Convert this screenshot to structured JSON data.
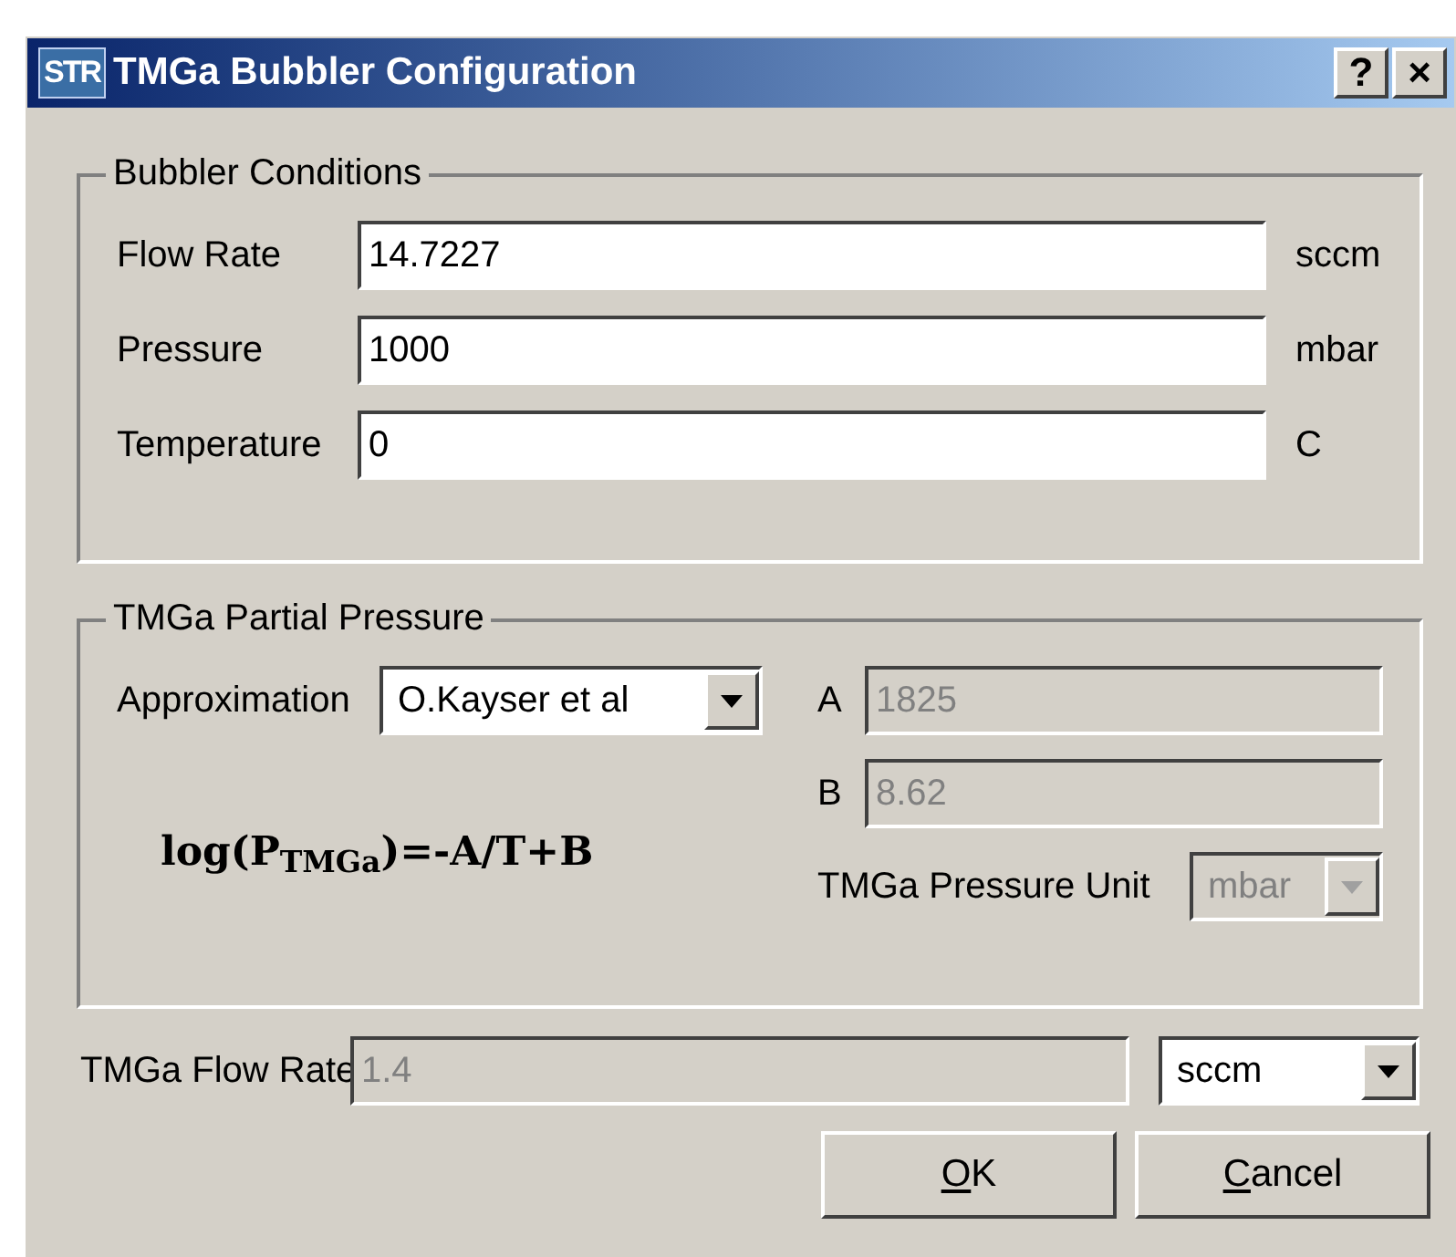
{
  "window": {
    "title": "TMGa Bubbler Configuration",
    "logo": "STR",
    "buttons": [
      "?",
      "×"
    ]
  },
  "bubbler_conditions": {
    "title": "Bubbler Conditions",
    "rows": [
      {
        "label": "Flow Rate",
        "value": "14.7227",
        "unit": "sccm"
      },
      {
        "label": "Pressure",
        "value": "1000",
        "unit": "mbar"
      },
      {
        "label": "Temperature",
        "value": "0",
        "unit": "C"
      }
    ]
  },
  "partial_pressure": {
    "title": "TMGa Partial Pressure",
    "approximation": {
      "label": "Approximation",
      "value": "O.Kayser et al"
    },
    "formula": "log(P$_{TMGa}$)=-A/T+B",
    "params": [
      {
        "label": "A",
        "value": "1825",
        "disabled": true
      },
      {
        "label": "B",
        "value": "8.62",
        "disabled": true
      }
    ],
    "unit": {
      "label": "TMGa Pressure Unit",
      "value": "mbar",
      "disabled": true
    }
  },
  "flow_rate": {
    "label": "TMGa Flow Rate",
    "value": "1.4",
    "disabled": true,
    "unit": "sccm"
  },
  "buttons": [
    {
      "label": "OK",
      "mnemonic_first": true
    },
    {
      "label": "Cancel",
      "mnemonic_first": true
    }
  ]
}
